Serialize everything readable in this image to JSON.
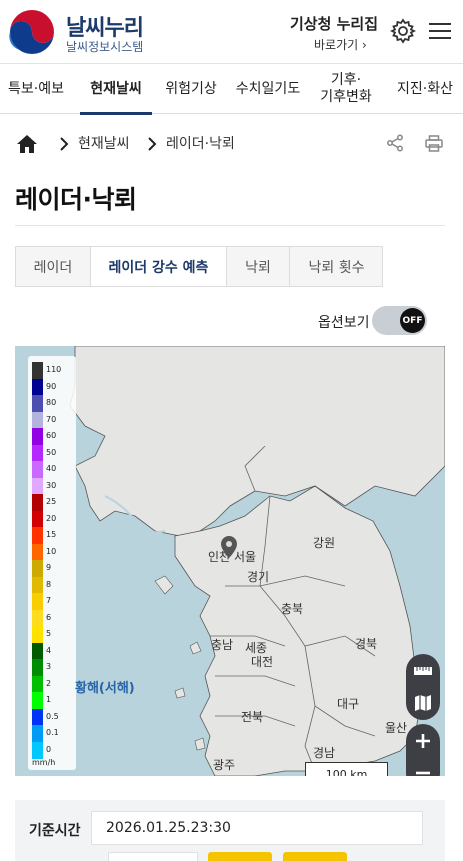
{
  "header": {
    "logo_title": "날씨누리",
    "logo_subtitle": "날씨정보시스템",
    "kma_title": "기상청 누리집",
    "kma_link": "바로가기 ›",
    "settings_icon": "gear-icon",
    "menu_icon": "hamburger-icon"
  },
  "gnb": [
    "특보·예보",
    "현재날씨",
    "위험기상",
    "수치일기도",
    "기후·\n기후변화",
    "지진·화산"
  ],
  "breadcrumb": {
    "level1": "현재날씨",
    "level2": "레이더·낙뢰"
  },
  "page_title": "레이더·낙뢰",
  "tabs": [
    "레이더",
    "레이더 강수 예측",
    "낙뢰",
    "낙뢰 횟수"
  ],
  "active_tab": "레이더 강수 예측",
  "options": {
    "label": "옵션보기",
    "toggle": "OFF"
  },
  "legend": {
    "values": [
      "110",
      "90",
      "80",
      "70",
      "60",
      "50",
      "40",
      "30",
      "25",
      "20",
      "15",
      "10",
      "9",
      "8",
      "7",
      "6",
      "5",
      "4",
      "3",
      "2",
      "1",
      "0.5",
      "0.1",
      "0"
    ],
    "unit": "mm/h",
    "colors": [
      "#333333",
      "#000390",
      "#4c4eb1",
      "#b3b4de",
      "#9300e4",
      "#b329ff",
      "#c969ff",
      "#e0a9ff",
      "#b40000",
      "#d20000",
      "#ff3200",
      "#ff6600",
      "#ccaa00",
      "#e0b900",
      "#f9cd00",
      "#ffdc1f",
      "#ffe100",
      "#005a00",
      "#008c00",
      "#00be00",
      "#00ff00",
      "#0033f5",
      "#009bf5",
      "#00c8ff"
    ]
  },
  "map": {
    "labels": {
      "seoul": "서울",
      "incheon": "인천",
      "gyeonggi": "경기",
      "gangwon": "강원",
      "chungbuk": "충북",
      "chungnam": "충남",
      "sejong": "세종",
      "daejeon": "대전",
      "gyeongbuk": "경북",
      "jeonbuk": "전북",
      "daegu": "대구",
      "ulsan": "울산",
      "gyeongnam": "경남",
      "gwangju": "광주",
      "sea": "황해(서해)"
    },
    "scale": "100 km"
  },
  "info": {
    "label": "기준시간",
    "value": "2026.01.25.23:30"
  }
}
